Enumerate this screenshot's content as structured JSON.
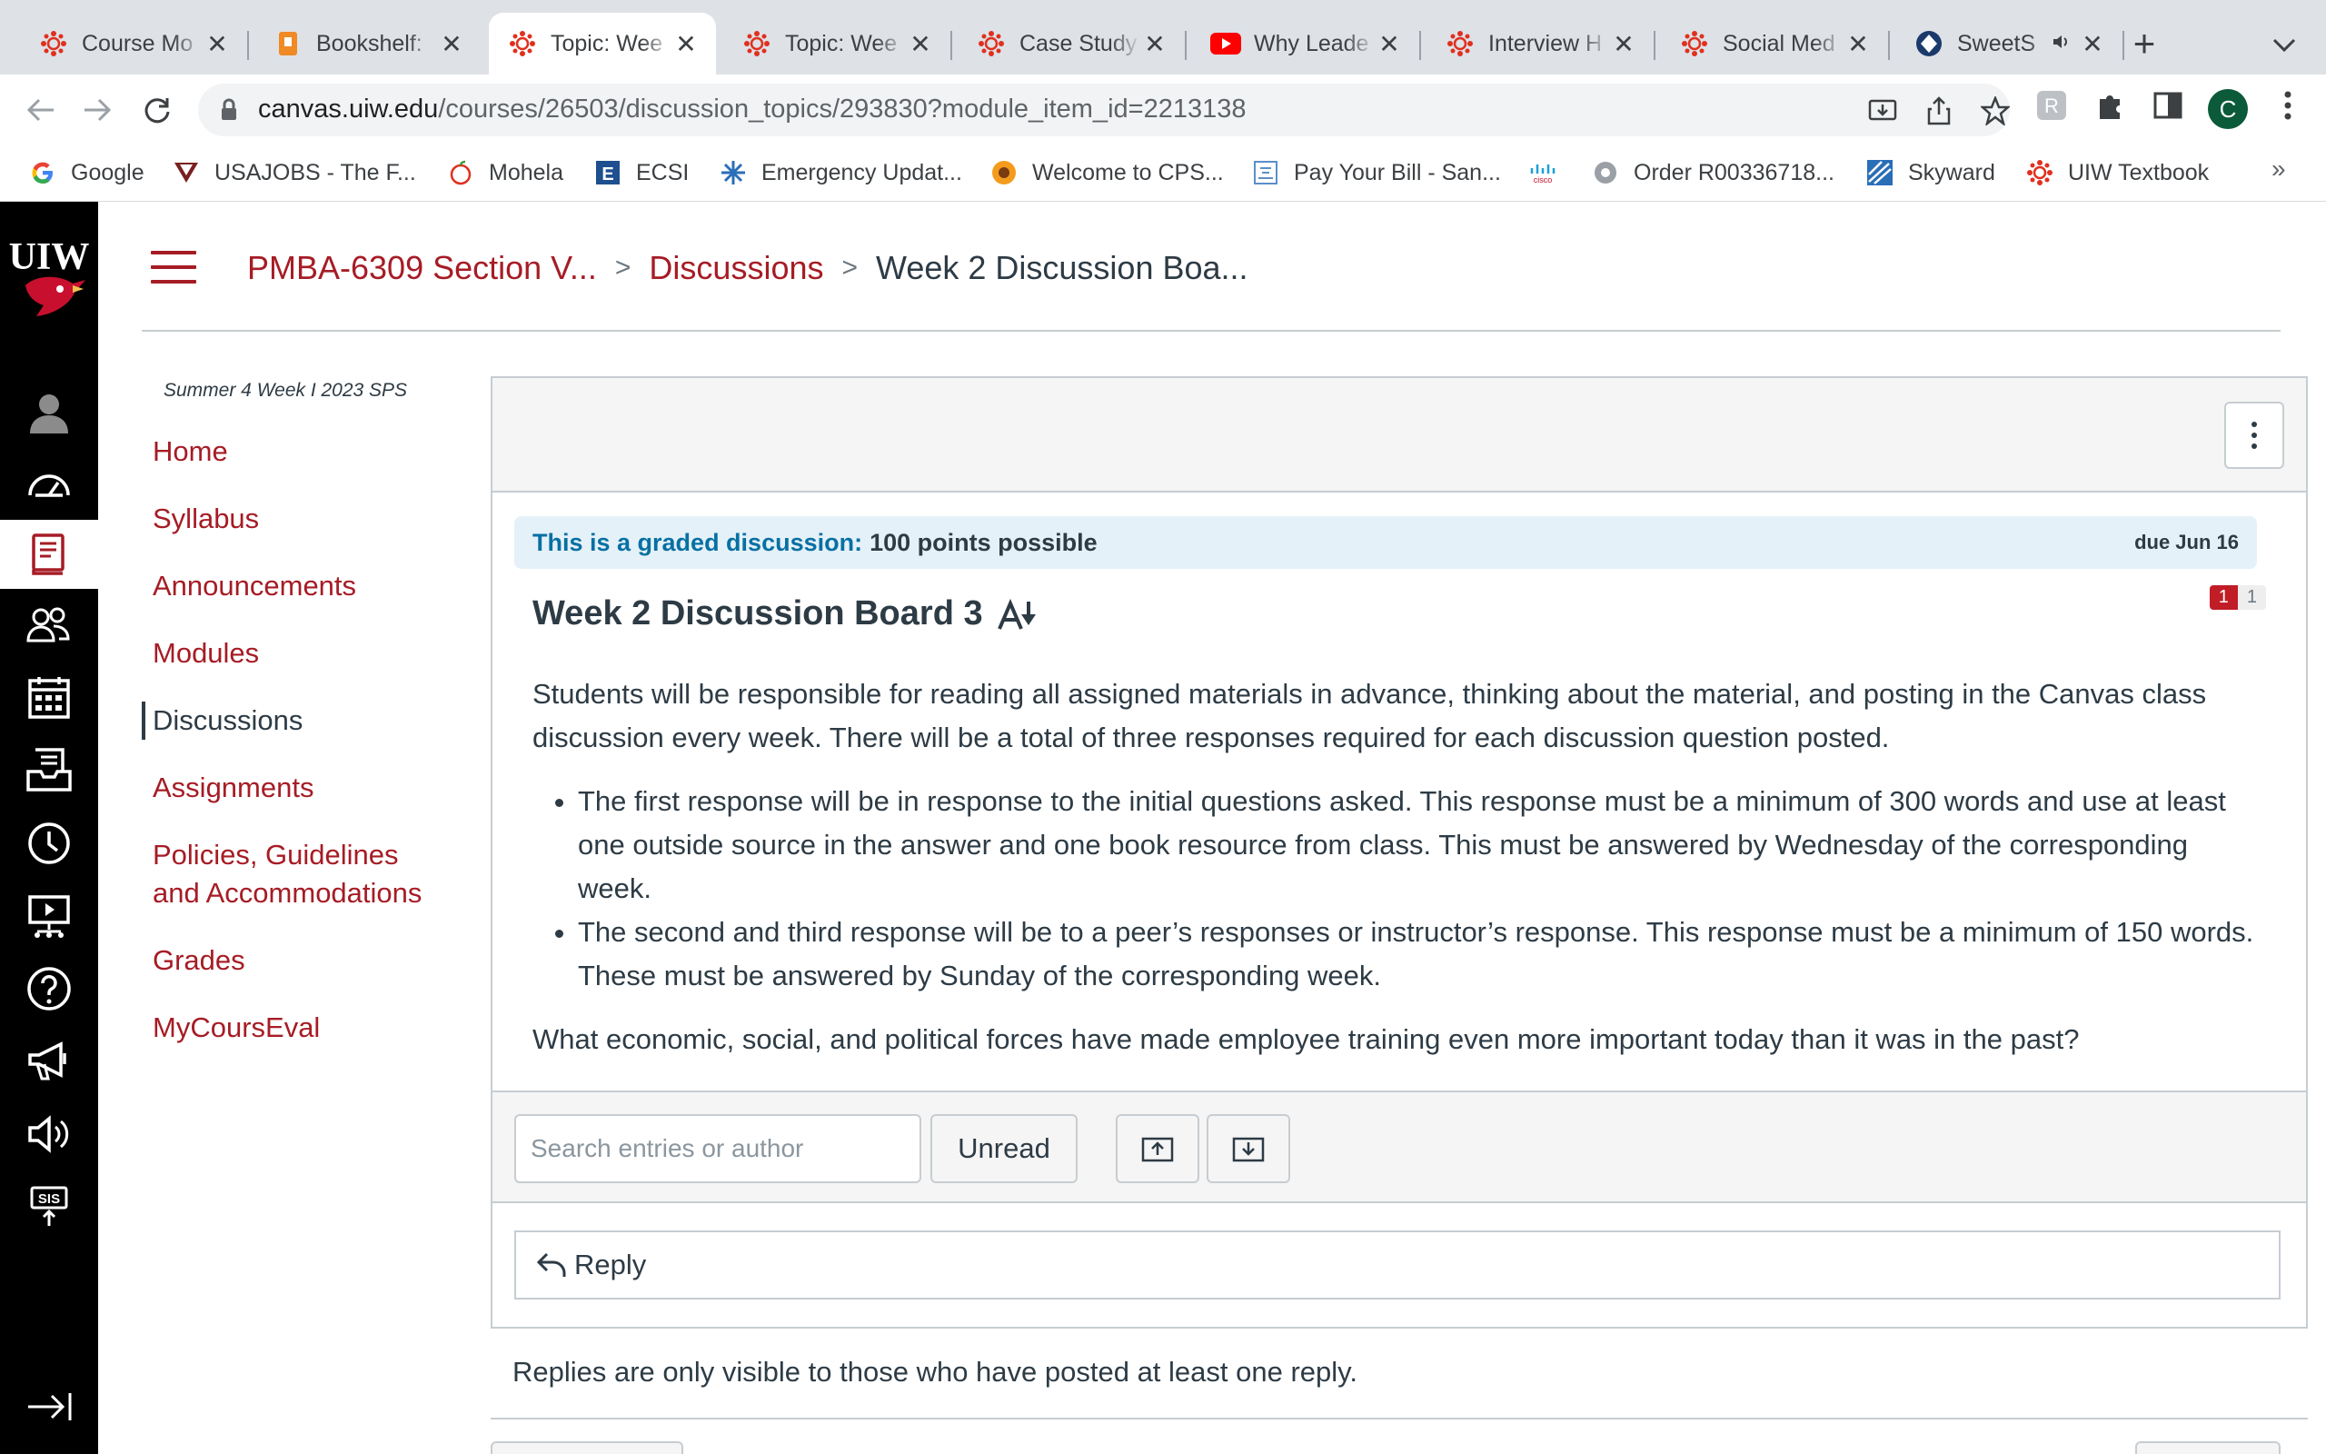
{
  "browser": {
    "tabs": [
      {
        "title": "Course Mo",
        "icon": "canvas-icon",
        "active": false
      },
      {
        "title": "Bookshelf:",
        "icon": "bookshelf-icon",
        "active": false
      },
      {
        "title": "Topic: Wee",
        "icon": "canvas-icon",
        "active": true
      },
      {
        "title": "Topic: Wee",
        "icon": "canvas-icon",
        "active": false
      },
      {
        "title": "Case Study",
        "icon": "canvas-icon",
        "active": false
      },
      {
        "title": "Why Leade",
        "icon": "youtube-icon",
        "active": false
      },
      {
        "title": "Interview H",
        "icon": "canvas-icon",
        "active": false
      },
      {
        "title": "Social Med",
        "icon": "canvas-icon",
        "active": false
      },
      {
        "title": "SweetS",
        "icon": "sweet-icon",
        "active": false,
        "audio": true
      }
    ],
    "close_glyph": "✕",
    "new_tab_glyph": "+",
    "url_host": "canvas.uiw.edu",
    "url_path": "/courses/26503/discussion_topics/293830?module_item_id=2213138",
    "profile_initial": "C",
    "bookmarks": [
      {
        "label": "Google",
        "icon": "google-icon"
      },
      {
        "label": "USAJOBS - The F...",
        "icon": "usajobs-icon"
      },
      {
        "label": "Mohela",
        "icon": "mohela-icon"
      },
      {
        "label": "ECSI",
        "icon": "ecsi-icon"
      },
      {
        "label": "Emergency Updat...",
        "icon": "emergency-icon"
      },
      {
        "label": "Welcome to CPS...",
        "icon": "cps-icon"
      },
      {
        "label": "Pay Your Bill - San...",
        "icon": "bill-icon"
      },
      {
        "label": "",
        "icon": "cisco-icon"
      },
      {
        "label": "Order R00336718...",
        "icon": "order-icon"
      },
      {
        "label": "Skyward",
        "icon": "skyward-icon"
      },
      {
        "label": "UIW Textbook",
        "icon": "canvas-icon"
      }
    ],
    "bookmarks_more": "»"
  },
  "colors": {
    "brand": "#a61c25",
    "link_blue": "#0770a3",
    "banner_bg": "#e5f1f8",
    "badge_red": "#c01d26"
  },
  "logo_text": "UIW",
  "breadcrumb": {
    "course": "PMBA-6309 Section V...",
    "section": "Discussions",
    "current": "Week 2 Discussion Boa...",
    "separator": ">"
  },
  "course_term": "Summer 4 Week I 2023 SPS",
  "course_nav": [
    {
      "label": "Home",
      "active": false
    },
    {
      "label": "Syllabus",
      "active": false
    },
    {
      "label": "Announcements",
      "active": false
    },
    {
      "label": "Modules",
      "active": false
    },
    {
      "label": "Discussions",
      "active": true
    },
    {
      "label": "Assignments",
      "active": false
    },
    {
      "label": "Policies, Guidelines and Accommodations",
      "active": false
    },
    {
      "label": "Grades",
      "active": false
    },
    {
      "label": "MyCoursEval",
      "active": false
    }
  ],
  "discussion": {
    "graded_label": "This is a graded discussion:",
    "points": "100 points possible",
    "due": "due Jun 16",
    "title": "Week 2 Discussion Board 3",
    "unread_count": "1",
    "total_count": "1",
    "intro": "Students will be responsible for reading all assigned materials in advance, thinking about the material, and posting in the Canvas class discussion every week. There will be a total of three responses required for each discussion question posted.",
    "bullets": [
      "The first response will be in response to the initial questions asked. This response must be a minimum of 300 words and use at least one outside source in the answer and one book resource from class. This must be answered by Wednesday of the corresponding week.",
      "The second and third response will be to a peer’s responses or instructor’s response. This response must be a minimum of 150 words. These must be answered by Sunday of the corresponding week."
    ],
    "question": "What economic, social, and political forces have made employee training even more important today than it was in the past?"
  },
  "toolbar": {
    "search_placeholder": "Search entries or author",
    "unread_label": "Unread"
  },
  "reply_label": "Reply",
  "replies_note": "Replies are only visible to those who have posted at least one reply."
}
